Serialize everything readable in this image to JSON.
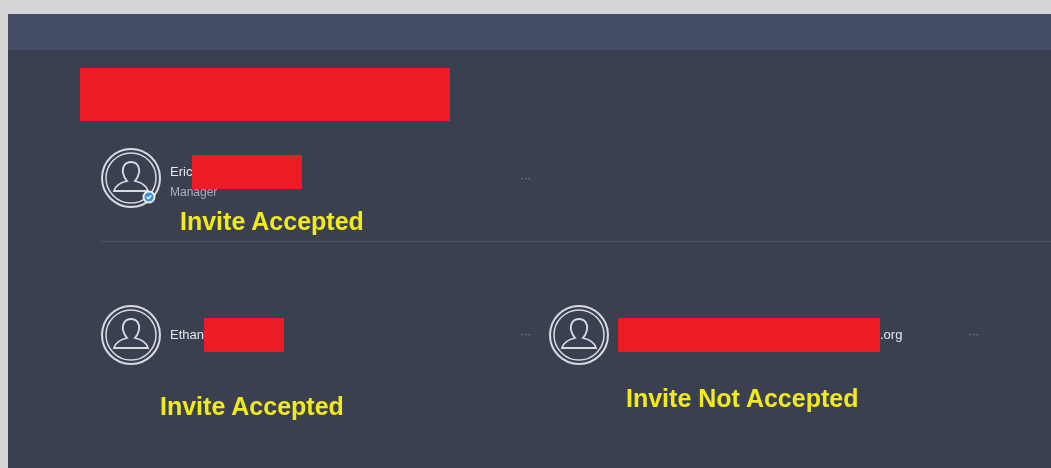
{
  "rows": [
    [
      {
        "kind": "name",
        "name": "Eric",
        "role": "Manager",
        "verified": true,
        "more": "···",
        "annotation": "Invite Accepted"
      }
    ],
    [
      {
        "kind": "name",
        "name": "Ethan",
        "verified": false,
        "more": "···",
        "annotation": "Invite Accepted"
      },
      {
        "kind": "email",
        "name": ".org",
        "verified": false,
        "more": "···",
        "annotation": "Invite Not Accepted"
      }
    ]
  ]
}
